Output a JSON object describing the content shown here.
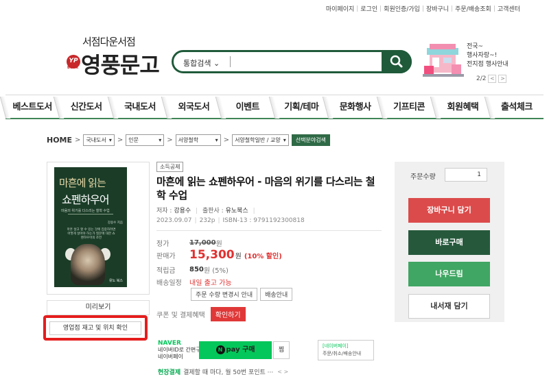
{
  "top_links": [
    "마이페이지",
    "로그인",
    "회원인증/가입",
    "장바구니",
    "주문/배송조회",
    "고객센터"
  ],
  "logo": {
    "sub": "서점다운서점",
    "main": "영풍문고",
    "badge": "YP",
    "badge_small": "BOOK"
  },
  "search": {
    "category": "통합검색",
    "query": ""
  },
  "event": {
    "line1": "전국~",
    "line2": "행사자랑~!",
    "line3": "전지점 행사안내",
    "page": "2/2",
    "prev": "<",
    "next": ">"
  },
  "nav": [
    "베스트도서",
    "신간도서",
    "국내도서",
    "외국도서",
    "이벤트",
    "기획/테마",
    "문화행사",
    "기프티콘",
    "회원혜택",
    "출석체크"
  ],
  "breadcrumb": {
    "home": "HOME",
    "sep": ">",
    "selects": [
      "국내도서",
      "인문",
      "서양철학",
      "서양철학일반 / 교양"
    ],
    "go": "선택분야검색"
  },
  "book": {
    "cover_title1": "마흔에 읽는",
    "cover_title2": "쇼펜하우어",
    "cover_sub": "마음의 위기를 다스리는 철학 수업",
    "cover_blurb": "마흔 살고 할 수 있는 것에 집중하려면 어떻게 살아야 하는가 질문에 대한 쇼펜하우어의 조언",
    "cover_author": "강용수 지음",
    "cover_pub": "유노 북스",
    "badge": "소득공제",
    "title": "마흔에 읽는 쇼펜하우어 - 마음의 위기를 다스리는 철학 수업",
    "author_label": "저자 :",
    "author": "강용수",
    "publisher_label": "출판사 :",
    "publisher": "유노북스",
    "date": "2023.09.07",
    "pages": "232p",
    "isbn": "ISBN-13 : 9791192300818",
    "preview": "미리보기",
    "stock_check": "영업점 재고 및 위치 확인"
  },
  "price": {
    "list_label": "정가",
    "list": "17,000",
    "list_unit": "원",
    "sale_label": "판매가",
    "sale": "15,300",
    "sale_unit": "원",
    "discount": "(10% 할인)",
    "points_label": "적립금",
    "points": "850",
    "points_unit": "원 (5%)",
    "ship_label": "배송일정",
    "ship": "내일 출고 가능",
    "ship_btn1": "주문 수량 변경시 안내",
    "ship_btn2": "배송안내",
    "coupon_label": "쿠폰 및 결제혜택",
    "coupon_btn": "확인하기"
  },
  "naver": {
    "brand": "NAVER",
    "line1": "네이버ID로 간편구매",
    "line2": "네이버페이",
    "pay_n": "N",
    "pay_label": "pay 구매",
    "jjim": "찜",
    "info1": "[네이버페이]",
    "info2": "주문/취소/배송안내"
  },
  "spot": {
    "label": "현장결제",
    "text": "결제할 때 마다, 월 50번 포인트 ···",
    "arrows": "< >"
  },
  "order": {
    "qty_label": "주문수량",
    "qty": "1",
    "cart": "장바구니 담기",
    "buy": "바로구매",
    "now": "나우드림",
    "library": "내서재 담기"
  }
}
